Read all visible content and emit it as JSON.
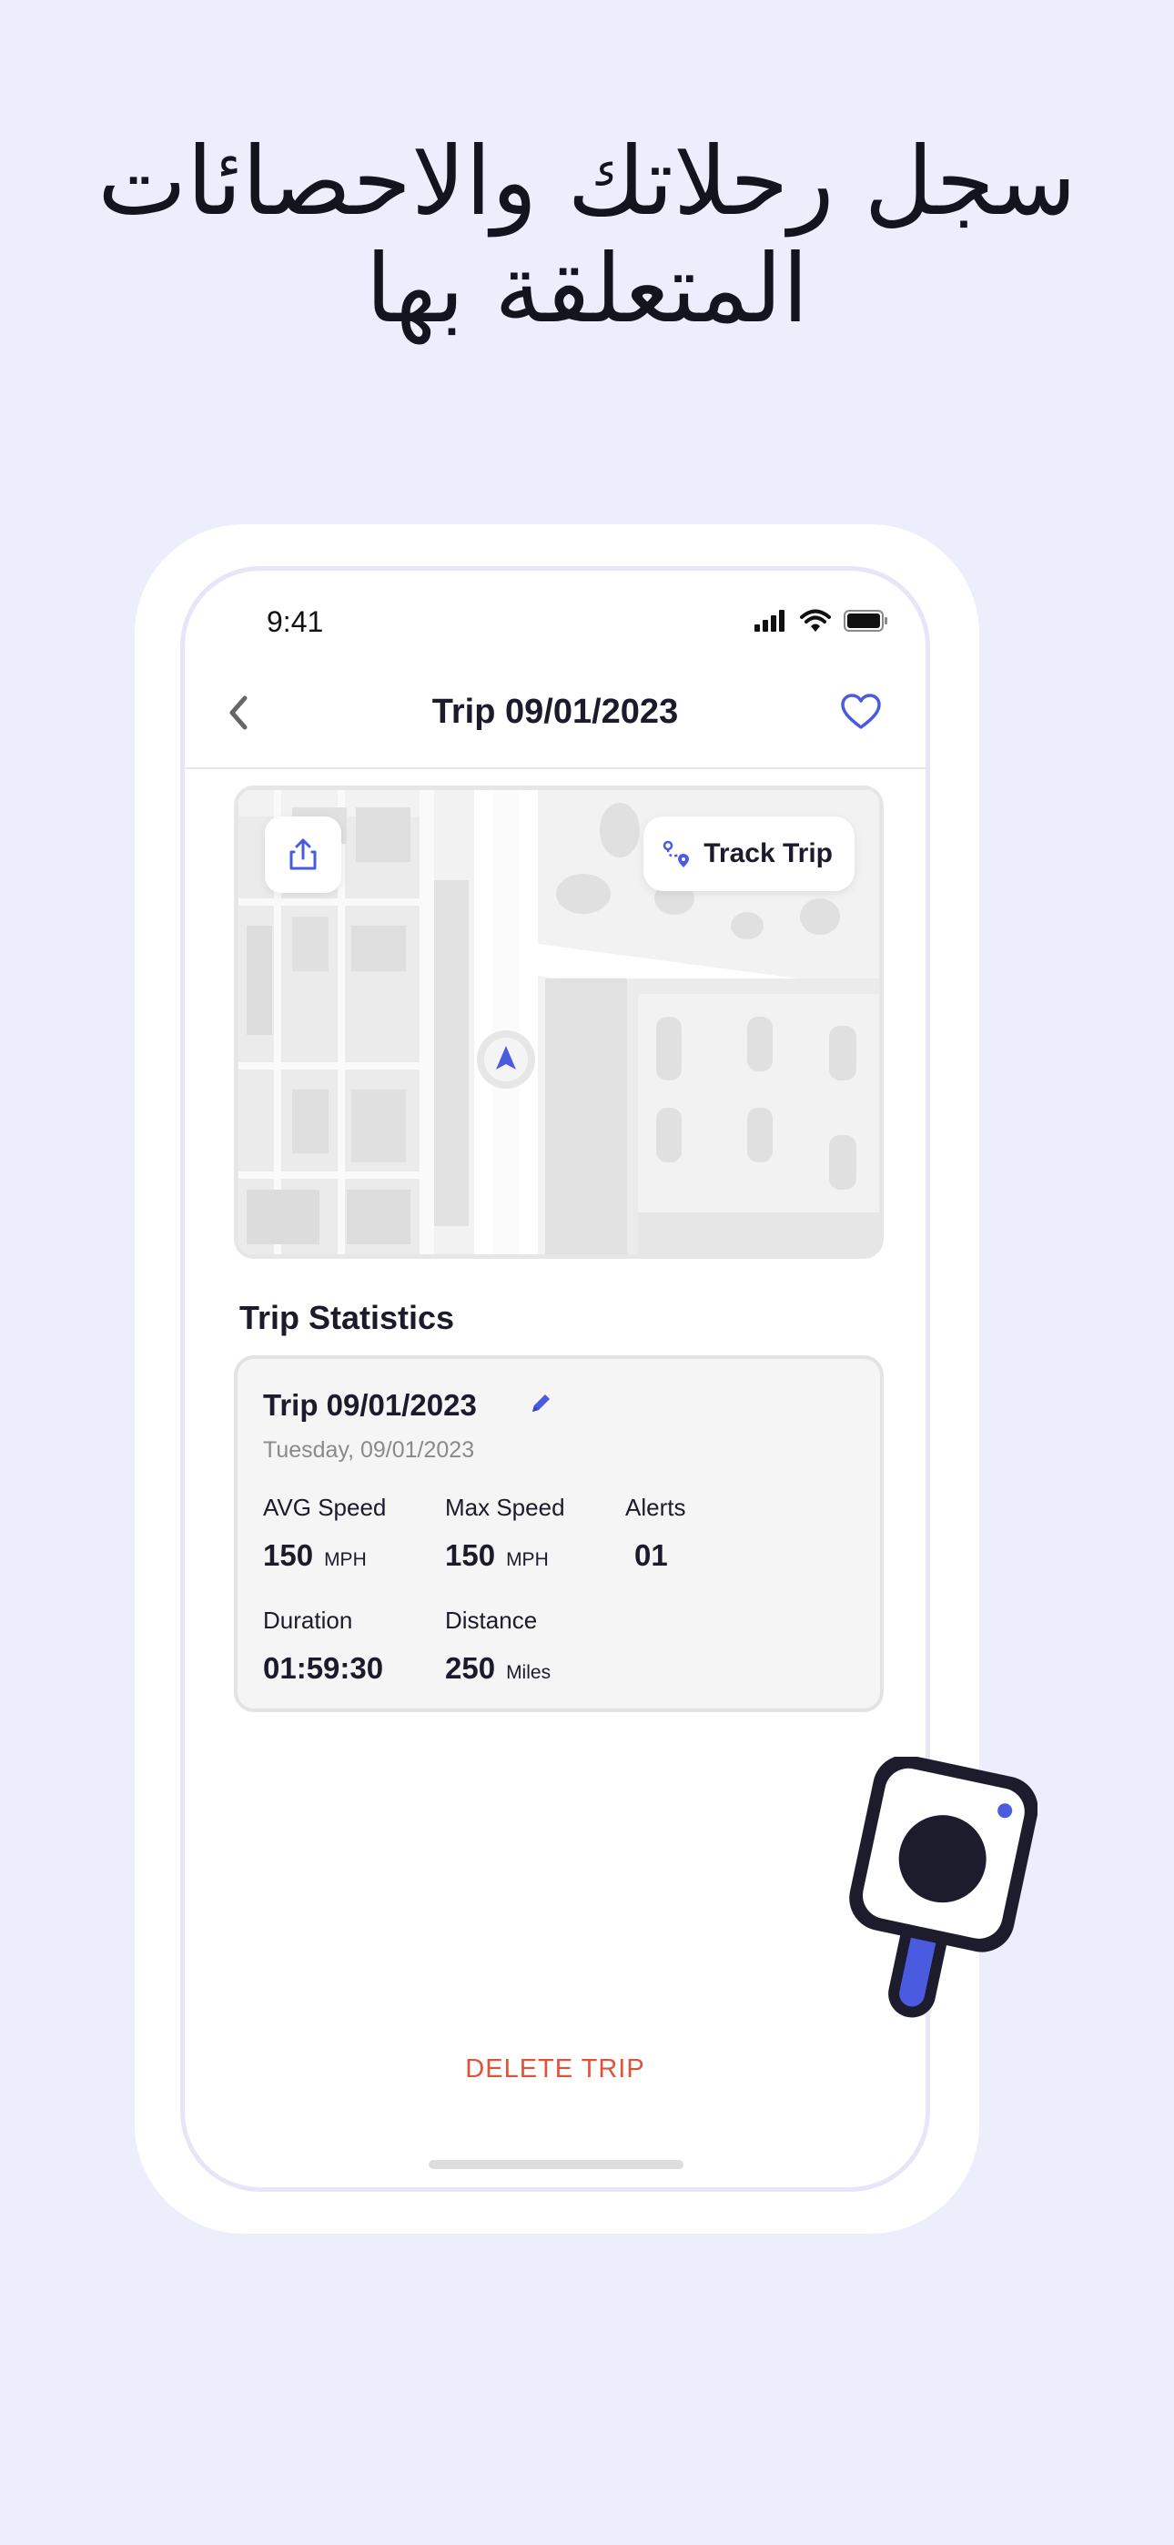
{
  "headline": {
    "line1": "سجل رحلاتك والاحصائات",
    "line2": "المتعلقة بها"
  },
  "status_bar": {
    "time": "9:41"
  },
  "nav": {
    "title": "Trip 09/01/2023",
    "back_icon": "chevron-left-icon",
    "favorite_icon": "heart-icon"
  },
  "map": {
    "share_icon": "share-icon",
    "track_trip_label": "Track Trip",
    "track_icon": "route-icon",
    "marker_icon": "navigation-arrow-icon"
  },
  "statistics": {
    "section_title": "Trip Statistics",
    "card": {
      "title": "Trip 09/01/2023",
      "date": "Tuesday, 09/01/2023",
      "edit_icon": "pencil-icon",
      "stats": [
        {
          "label": "AVG Speed",
          "value": "150",
          "unit": "MPH"
        },
        {
          "label": "Max Speed",
          "value": "150",
          "unit": "MPH"
        },
        {
          "label": "Alerts",
          "value": "01",
          "unit": ""
        },
        {
          "label": "Duration",
          "value": "01:59:30",
          "unit": ""
        },
        {
          "label": "Distance",
          "value": "250",
          "unit": "Miles"
        }
      ]
    }
  },
  "actions": {
    "delete_label": "DELETE TRIP"
  },
  "colors": {
    "background": "#eceefb",
    "accent": "#4a5be0",
    "danger": "#e0523a",
    "text": "#1b1b2b"
  }
}
